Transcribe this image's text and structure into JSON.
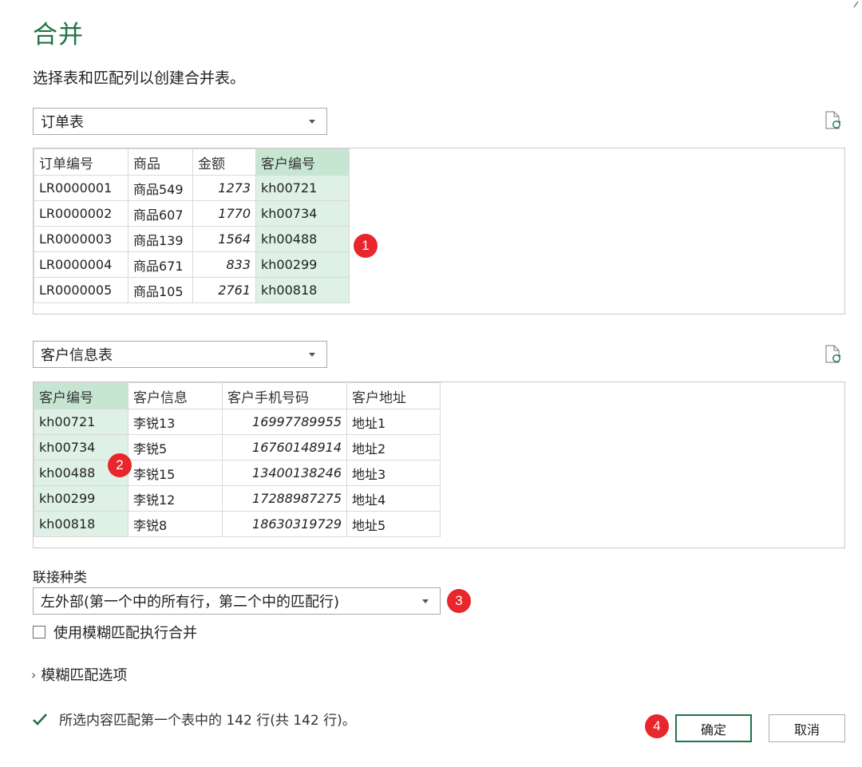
{
  "dialog": {
    "title": "合并",
    "subtitle": "选择表和匹配列以创建合并表。"
  },
  "table1": {
    "selected": "订单表",
    "columns": [
      "订单编号",
      "商品",
      "金额",
      "客户编号"
    ],
    "rows": [
      [
        "LR0000001",
        "商品549",
        "1273",
        "kh00721"
      ],
      [
        "LR0000002",
        "商品607",
        "1770",
        "kh00734"
      ],
      [
        "LR0000003",
        "商品139",
        "1564",
        "kh00488"
      ],
      [
        "LR0000004",
        "商品671",
        "833",
        "kh00299"
      ],
      [
        "LR0000005",
        "商品105",
        "2761",
        "kh00818"
      ]
    ],
    "badge": "1"
  },
  "table2": {
    "selected": "客户信息表",
    "columns": [
      "客户编号",
      "客户信息",
      "客户手机号码",
      "客户地址"
    ],
    "rows": [
      [
        "kh00721",
        "李锐13",
        "16997789955",
        "地址1"
      ],
      [
        "kh00734",
        "李锐5",
        "16760148914",
        "地址2"
      ],
      [
        "kh00488",
        "李锐15",
        "13400138246",
        "地址3"
      ],
      [
        "kh00299",
        "李锐12",
        "17288987275",
        "地址4"
      ],
      [
        "kh00818",
        "李锐8",
        "18630319729",
        "地址5"
      ]
    ],
    "badge": "2"
  },
  "join": {
    "label": "联接种类",
    "selected": "左外部(第一个中的所有行，第二个中的匹配行)",
    "badge": "3"
  },
  "fuzzy": {
    "checkbox_label": "使用模糊匹配执行合并",
    "checked": false,
    "options_label": "模糊匹配选项"
  },
  "status": {
    "text": "所选内容匹配第一个表中的 142 行(共 142 行)。"
  },
  "buttons": {
    "ok": "确定",
    "cancel": "取消",
    "badge": "4"
  },
  "colors": {
    "accent": "#217346",
    "selected_column": "#dff0e6",
    "badge": "#e8262b"
  }
}
